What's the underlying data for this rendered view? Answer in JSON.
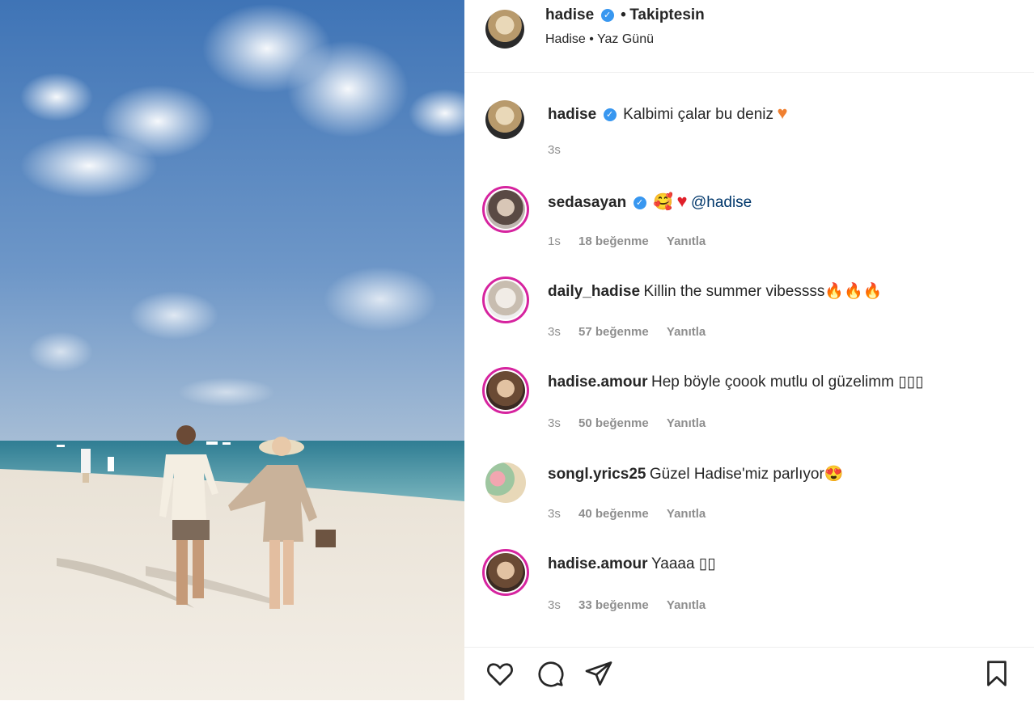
{
  "post": {
    "photo_alt": "beach-photo",
    "author": {
      "username": "hadise",
      "follow_status": "Takiptesin",
      "subtitle_1": "Hadise",
      "subtitle_2": "Yaz Günü"
    },
    "caption": {
      "username": "hadise",
      "text": "Kalbimi çalar bu deniz",
      "time": "3s"
    }
  },
  "comments": [
    {
      "username": "sedasayan",
      "verified": true,
      "text": "@hadise",
      "time": "1s",
      "likes": "18 beğenme",
      "reply": "Yanıtla"
    },
    {
      "username": "daily_hadise",
      "verified": false,
      "text": "Killin the summer vibessss🔥🔥🔥",
      "time": "3s",
      "likes": "57 beğenme",
      "reply": "Yanıtla"
    },
    {
      "username": "hadise.amour",
      "verified": false,
      "text": "Hep böyle çoook mutlu ol güzelimm ▯▯▯",
      "time": "3s",
      "likes": "50 beğenme",
      "reply": "Yanıtla"
    },
    {
      "username": "songl.yrics25",
      "verified": false,
      "text": "Güzel Hadise'miz parlıyor😍",
      "time": "3s",
      "likes": "40 beğenme",
      "reply": "Yanıtla"
    },
    {
      "username": "hadise.amour",
      "verified": false,
      "text": "Yaaaa ▯▯",
      "time": "3s",
      "likes": "33 beğenme",
      "reply": "Yanıtla"
    }
  ],
  "actions": {
    "like": "heart-icon",
    "comment": "comment-icon",
    "share": "share-icon",
    "save": "bookmark-icon"
  },
  "colors": {
    "verified": "#3897f0",
    "username": "#262626",
    "meta": "#8e8e8e",
    "ring": "#d6249f"
  }
}
